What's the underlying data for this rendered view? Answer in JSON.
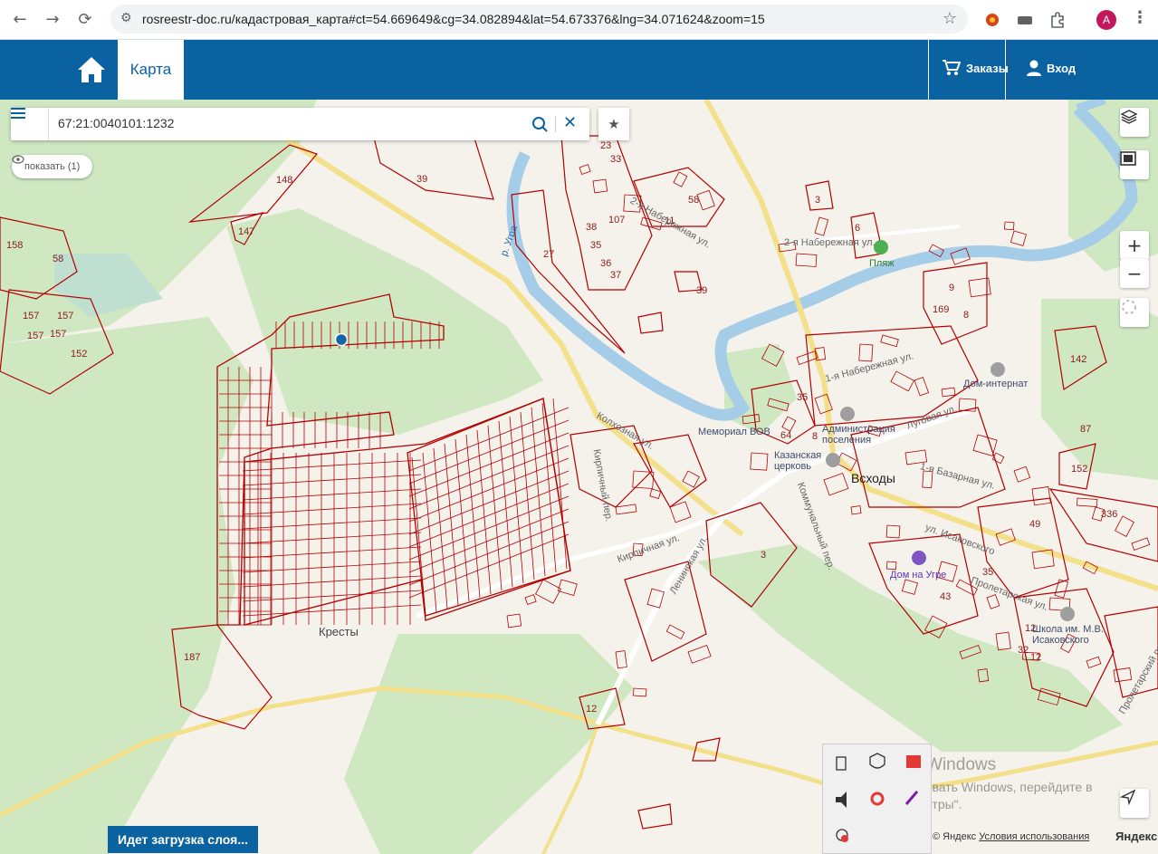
{
  "browser": {
    "url": "rosreestr-doc.ru/кадастровая_карта#ct=54.669649&cg=34.082894&lat=54.673376&lng=34.071624&zoom=15",
    "back_glyph": "←",
    "forward_glyph": "→",
    "reload_glyph": "⟳",
    "star_glyph": "☆",
    "profile_initial": "A",
    "menu_glyph": "⋮"
  },
  "header": {
    "tab_map": "Карта",
    "orders_label": "Заказы",
    "login_label": "Вход",
    "accent_color": "#0a62a0"
  },
  "search": {
    "value": "67:21:0040101:1232",
    "clear_glyph": "✕",
    "fav_glyph": "★",
    "show_label": "показать (1)"
  },
  "controls": {
    "zoom_in": "+",
    "zoom_out": "−"
  },
  "map": {
    "parcel_labels": [
      "23",
      "33",
      "58",
      "3",
      "107",
      "11",
      "38",
      "35",
      "36",
      "37",
      "27",
      "39",
      "148",
      "39",
      "147",
      "158",
      "58",
      "157",
      "157",
      "157",
      "157",
      "152",
      "9",
      "169",
      "142",
      "35",
      "64",
      "8",
      "152",
      "87",
      "336",
      "49",
      "35",
      "43",
      "12",
      "32",
      "12",
      "3",
      "187",
      "12",
      "6",
      "8"
    ],
    "place_labels": [
      "Кресты",
      "Всходы"
    ],
    "street_labels": [
      "2-я Набережная ул.",
      "2-я Набережная ул.",
      "1-я Набережная ул.",
      "Колхозная ул.",
      "Кирпичный пер.",
      "Кирпичная ул.",
      "Ленинская ул.",
      "Коммунальный пер.",
      "ул. Исаковского",
      "Пролетарская ул.",
      "Пролетарский пер.",
      "1-я Базарная ул.",
      "Луговая ул.",
      "р. Угра"
    ],
    "poi_labels": [
      "Пляж",
      "Дом-интернат",
      "Мемориал ВОВ",
      "Администрация поселения",
      "Казанская церковь",
      "Дом на Угре",
      "Школа им. М.В. Исаковского"
    ]
  },
  "status": {
    "loading_label": "Идет загрузка слоя..."
  },
  "windows": {
    "activation_title": "Активация Windows",
    "activation_text": "Чтобы активировать Windows, перейдите в раздел \"Параметры\"."
  },
  "footer": {
    "copyright": "© Яндекс",
    "terms": "Условия использования",
    "logo": "Яндекс"
  }
}
